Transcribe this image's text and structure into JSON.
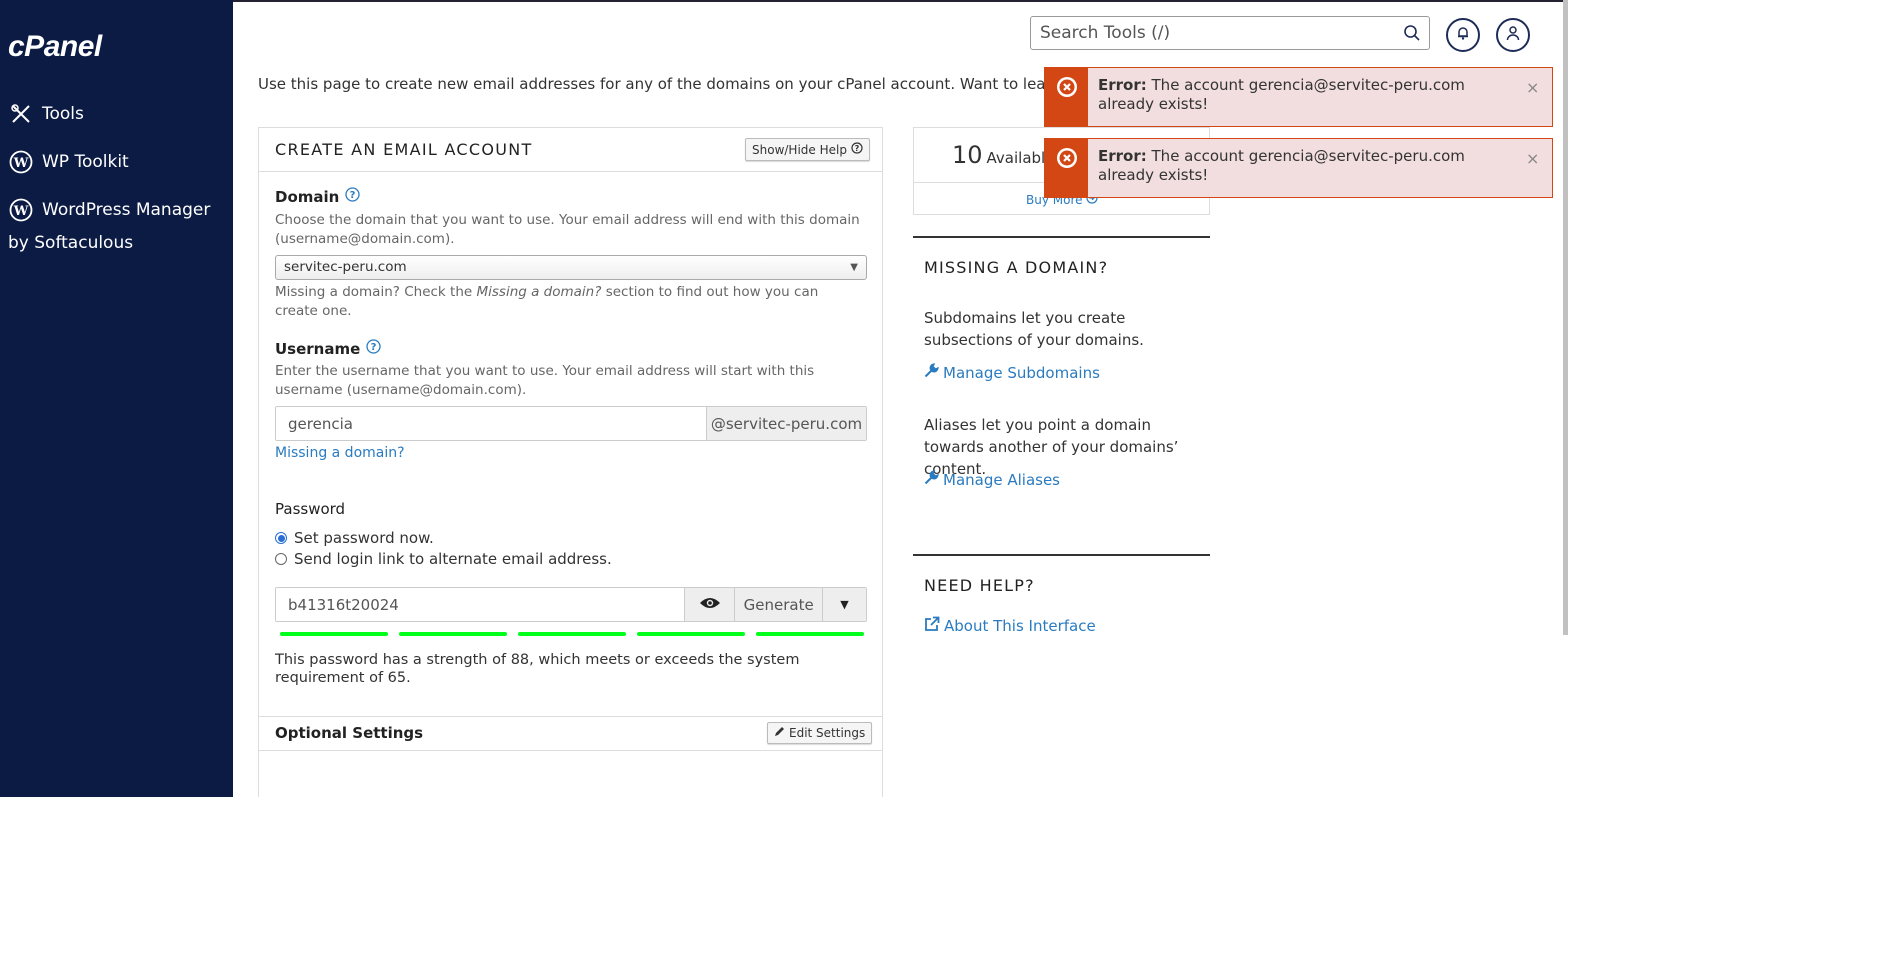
{
  "sidebar": {
    "logo": "cPanel",
    "items": [
      {
        "label": "Tools",
        "icon": "tools-icon"
      },
      {
        "label": "WP Toolkit",
        "icon": "wordpress-icon"
      },
      {
        "label": "WordPress Manager",
        "icon": "wordpress-icon"
      }
    ],
    "sub_label": "by Softaculous"
  },
  "header": {
    "search_placeholder": "Search Tools (/)"
  },
  "intro": "Use this page to create new email addresses for any of the domains on your cPanel account. Want to learn more? Re",
  "form": {
    "title": "CREATE AN EMAIL ACCOUNT",
    "show_hide_help": "Show/Hide Help",
    "domain": {
      "label": "Domain",
      "help": "Choose the domain that you want to use. Your email address will end with this domain (username@domain.com).",
      "value": "servitec-peru.com",
      "missing_pre": "Missing a domain? Check the ",
      "missing_em": "Missing a domain?",
      "missing_post": " section to find out how you can create one."
    },
    "username": {
      "label": "Username",
      "help": "Enter the username that you want to use. Your email address will start with this username (username@domain.com).",
      "value": "gerencia",
      "suffix": "@servitec-peru.com",
      "missing_link": "Missing a domain?"
    },
    "password": {
      "label": "Password",
      "option_set": "Set password now.",
      "option_send": "Send login link to alternate email address.",
      "value": "b41316t20024",
      "generate": "Generate",
      "strength_text": "This password has a strength of 88, which meets or exceeds the system requirement of 65.",
      "strength": 88,
      "strength_color": "#00ff1a"
    },
    "optional": {
      "label": "Optional Settings",
      "edit_button": "Edit Settings"
    }
  },
  "available": {
    "count": "10",
    "label": "Available",
    "buy_more": "Buy More"
  },
  "missing_domain": {
    "title": "MISSING A DOMAIN?",
    "text1": "Subdomains let you create subsections of your domains.",
    "link1": "Manage Subdomains",
    "text2": "Aliases let you point a domain towards another of your domains’ content.",
    "link2": "Manage Aliases"
  },
  "need_help": {
    "title": "NEED HELP?",
    "link": "About This Interface"
  },
  "errors": [
    {
      "prefix": "Error:",
      "message": " The account gerencia@servitec-peru.com already exists!"
    },
    {
      "prefix": "Error:",
      "message": " The account gerencia@servitec-peru.com already exists!"
    }
  ],
  "colors": {
    "sidebar": "#0b1b44",
    "link": "#2a7bbf",
    "error": "#d34715",
    "error_bg": "#f2dede"
  }
}
